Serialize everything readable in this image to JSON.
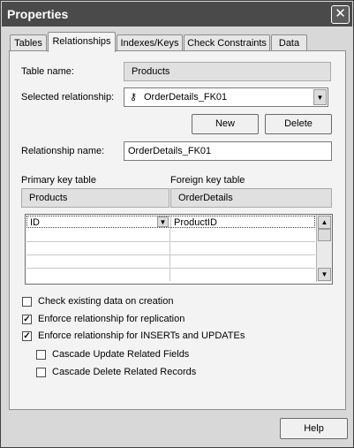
{
  "window": {
    "title": "Properties"
  },
  "tabs": [
    {
      "label": "Tables",
      "active": false
    },
    {
      "label": "Relationships",
      "active": true
    },
    {
      "label": "Indexes/Keys",
      "active": false
    },
    {
      "label": "Check Constraints",
      "active": false
    },
    {
      "label": "Data",
      "active": false
    }
  ],
  "form": {
    "table_name_label": "Table name:",
    "table_name_value": "Products",
    "selected_relationship_label": "Selected relationship:",
    "selected_relationship_value": "OrderDetails_FK01",
    "new_button": "New",
    "delete_button": "Delete",
    "relationship_name_label": "Relationship name:",
    "relationship_name_value": "OrderDetails_FK01",
    "primary_key_label": "Primary key table",
    "primary_key_value": "Products",
    "foreign_key_label": "Foreign key table",
    "foreign_key_value": "OrderDetails"
  },
  "grid": {
    "rows": [
      {
        "primary": "ID",
        "foreign": "ProductID"
      },
      {
        "primary": "",
        "foreign": ""
      },
      {
        "primary": "",
        "foreign": ""
      },
      {
        "primary": "",
        "foreign": ""
      },
      {
        "primary": "",
        "foreign": ""
      }
    ]
  },
  "options": [
    {
      "label": "Check existing data on creation",
      "checked": false
    },
    {
      "label": "Enforce relationship for replication",
      "checked": true
    },
    {
      "label": "Enforce relationship for INSERTs and UPDATEs",
      "checked": true
    },
    {
      "label": "Cascade Update Related Fields",
      "checked": false
    },
    {
      "label": "Cascade Delete Related Records",
      "checked": false
    }
  ],
  "footer": {
    "help_button": "Help"
  },
  "icons": {
    "relationship": "key-icon",
    "close": "close-icon",
    "dropdown": "chevron-down-icon"
  }
}
